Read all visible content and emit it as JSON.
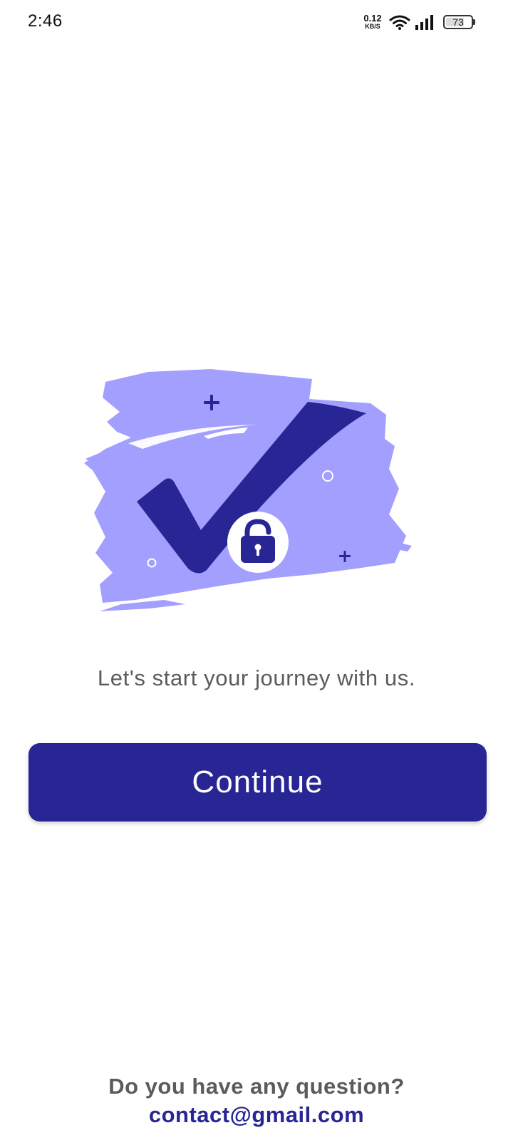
{
  "status_bar": {
    "time": "2:46",
    "net_speed_value": "0.12",
    "net_speed_unit": "KB/S",
    "battery_level": "73",
    "battery_fraction": 0.73
  },
  "illustration": {
    "icons": [
      "checkmark-icon",
      "unlocked-padlock-icon",
      "plus-icon",
      "circle-icon"
    ],
    "colors": {
      "brush": "#a29ffe",
      "accent": "#282594",
      "badge": "#ffffff"
    }
  },
  "main": {
    "tagline": "Let's start your journey with us.",
    "continue_label": "Continue"
  },
  "footer": {
    "question": "Do you have any question?",
    "email": "contact@gmail.com"
  },
  "colors": {
    "primary": "#282594",
    "text_secondary": "#5b5b5b",
    "background": "#ffffff"
  }
}
